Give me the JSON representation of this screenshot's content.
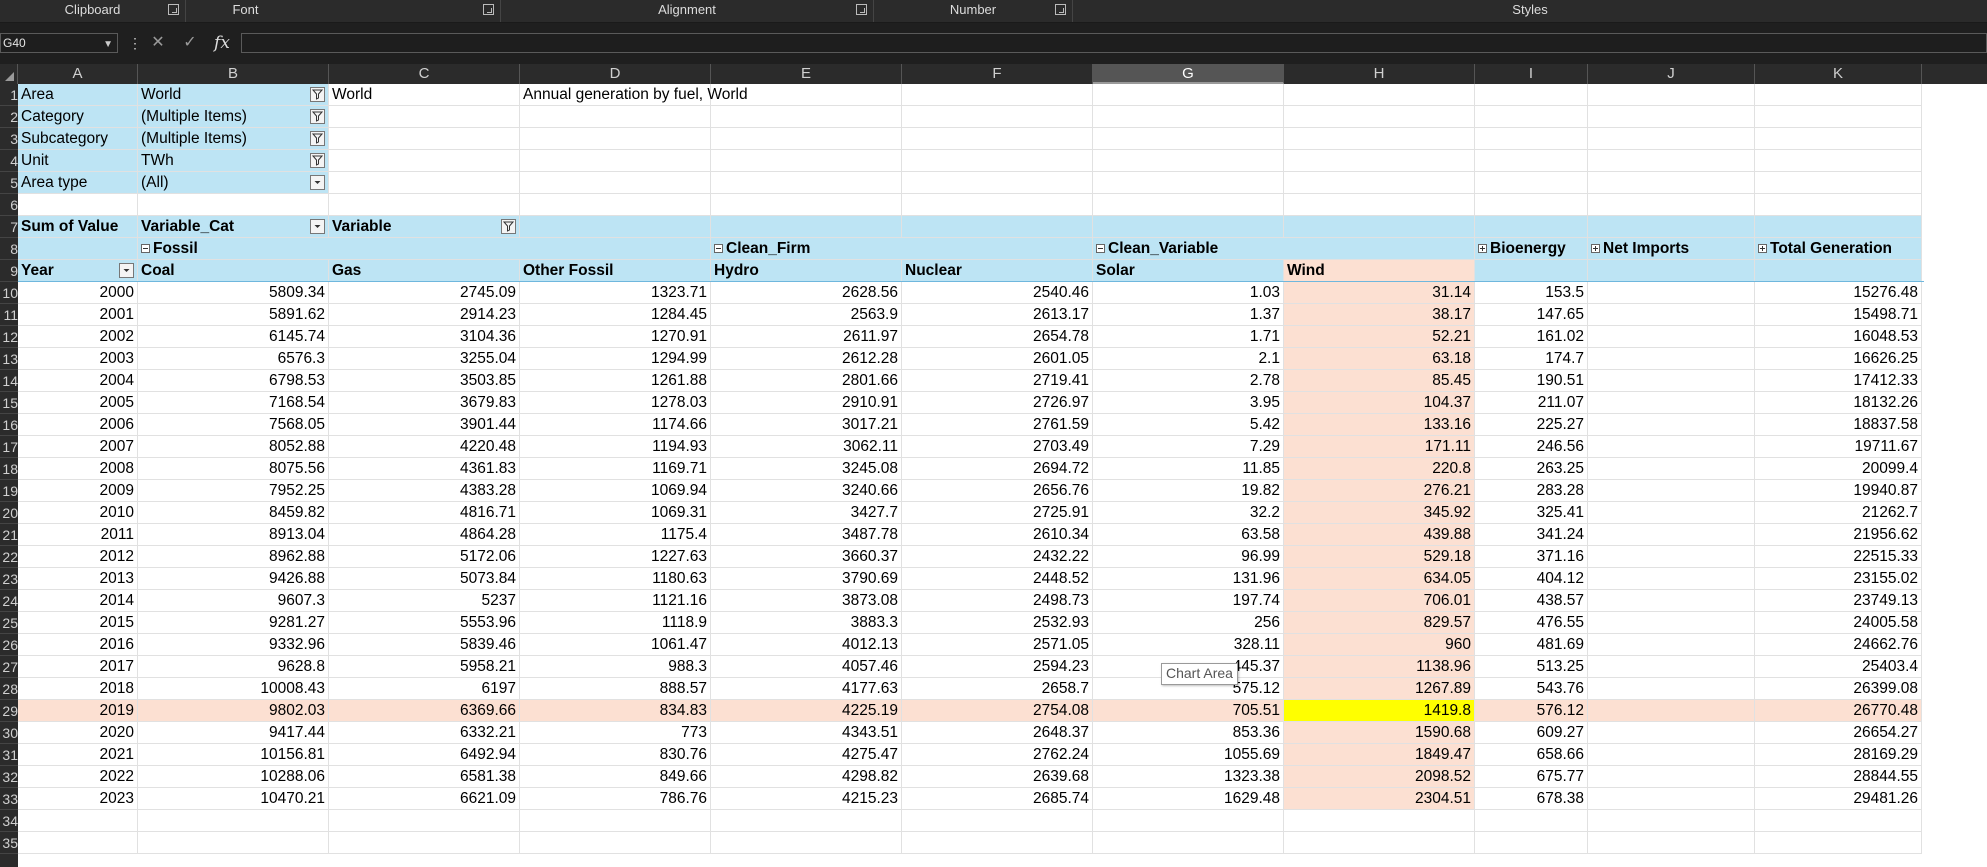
{
  "ribbon": {
    "groups": [
      {
        "label": "Clipboard"
      },
      {
        "label": "Font"
      },
      {
        "label": "Alignment"
      },
      {
        "label": "Number"
      },
      {
        "label": "Styles"
      }
    ]
  },
  "formula_bar": {
    "name_box": "G40",
    "value": ""
  },
  "columns": [
    "A",
    "B",
    "C",
    "D",
    "E",
    "F",
    "G",
    "H",
    "I",
    "J",
    "K"
  ],
  "selected_column": "G",
  "rows": [
    "1",
    "2",
    "3",
    "4",
    "5",
    "6",
    "7",
    "8",
    "9",
    "10",
    "11",
    "12",
    "13",
    "14",
    "15",
    "16",
    "17",
    "18",
    "19",
    "20",
    "21",
    "22",
    "23",
    "24",
    "25",
    "26",
    "27",
    "28",
    "29",
    "30",
    "31",
    "32",
    "33",
    "34",
    "35"
  ],
  "filters": [
    {
      "label": "Area",
      "value": "World"
    },
    {
      "label": "Category",
      "value": "(Multiple Items)"
    },
    {
      "label": "Subcategory",
      "value": "(Multiple Items)"
    },
    {
      "label": "Unit",
      "value": "TWh"
    },
    {
      "label": "Area type",
      "value": "(All)"
    }
  ],
  "extra": {
    "c1": "World",
    "d1": "Annual generation by fuel, World"
  },
  "pivot": {
    "sum_label": "Sum of Value",
    "col_field1": "Variable_Cat",
    "col_field2": "Variable",
    "groups": {
      "fossil": "Fossil",
      "clean_firm": "Clean_Firm",
      "clean_variable": "Clean_Variable",
      "bioenergy": "Bioenergy",
      "net_imports": "Net Imports",
      "total": "Total Generation"
    },
    "row_field": "Year",
    "headers": [
      "Coal",
      "Gas",
      "Other Fossil",
      "Hydro",
      "Nuclear",
      "Solar",
      "Wind"
    ],
    "data": [
      [
        "2000",
        "5809.34",
        "2745.09",
        "1323.71",
        "2628.56",
        "2540.46",
        "1.03",
        "31.14",
        "153.5",
        "",
        "15276.48"
      ],
      [
        "2001",
        "5891.62",
        "2914.23",
        "1284.45",
        "2563.9",
        "2613.17",
        "1.37",
        "38.17",
        "147.65",
        "",
        "15498.71"
      ],
      [
        "2002",
        "6145.74",
        "3104.36",
        "1270.91",
        "2611.97",
        "2654.78",
        "1.71",
        "52.21",
        "161.02",
        "",
        "16048.53"
      ],
      [
        "2003",
        "6576.3",
        "3255.04",
        "1294.99",
        "2612.28",
        "2601.05",
        "2.1",
        "63.18",
        "174.7",
        "",
        "16626.25"
      ],
      [
        "2004",
        "6798.53",
        "3503.85",
        "1261.88",
        "2801.66",
        "2719.41",
        "2.78",
        "85.45",
        "190.51",
        "",
        "17412.33"
      ],
      [
        "2005",
        "7168.54",
        "3679.83",
        "1278.03",
        "2910.91",
        "2726.97",
        "3.95",
        "104.37",
        "211.07",
        "",
        "18132.26"
      ],
      [
        "2006",
        "7568.05",
        "3901.44",
        "1174.66",
        "3017.21",
        "2761.59",
        "5.42",
        "133.16",
        "225.27",
        "",
        "18837.58"
      ],
      [
        "2007",
        "8052.88",
        "4220.48",
        "1194.93",
        "3062.11",
        "2703.49",
        "7.29",
        "171.11",
        "246.56",
        "",
        "19711.67"
      ],
      [
        "2008",
        "8075.56",
        "4361.83",
        "1169.71",
        "3245.08",
        "2694.72",
        "11.85",
        "220.8",
        "263.25",
        "",
        "20099.4"
      ],
      [
        "2009",
        "7952.25",
        "4383.28",
        "1069.94",
        "3240.66",
        "2656.76",
        "19.82",
        "276.21",
        "283.28",
        "",
        "19940.87"
      ],
      [
        "2010",
        "8459.82",
        "4816.71",
        "1069.31",
        "3427.7",
        "2725.91",
        "32.2",
        "345.92",
        "325.41",
        "",
        "21262.7"
      ],
      [
        "2011",
        "8913.04",
        "4864.28",
        "1175.4",
        "3487.78",
        "2610.34",
        "63.58",
        "439.88",
        "341.24",
        "",
        "21956.62"
      ],
      [
        "2012",
        "8962.88",
        "5172.06",
        "1227.63",
        "3660.37",
        "2432.22",
        "96.99",
        "529.18",
        "371.16",
        "",
        "22515.33"
      ],
      [
        "2013",
        "9426.88",
        "5073.84",
        "1180.63",
        "3790.69",
        "2448.52",
        "131.96",
        "634.05",
        "404.12",
        "",
        "23155.02"
      ],
      [
        "2014",
        "9607.3",
        "5237",
        "1121.16",
        "3873.08",
        "2498.73",
        "197.74",
        "706.01",
        "438.57",
        "",
        "23749.13"
      ],
      [
        "2015",
        "9281.27",
        "5553.96",
        "1118.9",
        "3883.3",
        "2532.93",
        "256",
        "829.57",
        "476.55",
        "",
        "24005.58"
      ],
      [
        "2016",
        "9332.96",
        "5839.46",
        "1061.47",
        "4012.13",
        "2571.05",
        "328.11",
        "960",
        "481.69",
        "",
        "24662.76"
      ],
      [
        "2017",
        "9628.8",
        "5958.21",
        "988.3",
        "4057.46",
        "2594.23",
        "445.37",
        "1138.96",
        "513.25",
        "",
        "25403.4"
      ],
      [
        "2018",
        "10008.43",
        "6197",
        "888.57",
        "4177.63",
        "2658.7",
        "575.12",
        "1267.89",
        "543.76",
        "",
        "26399.08"
      ],
      [
        "2019",
        "9802.03",
        "6369.66",
        "834.83",
        "4225.19",
        "2754.08",
        "705.51",
        "1419.8",
        "576.12",
        "",
        "26770.48"
      ],
      [
        "2020",
        "9417.44",
        "6332.21",
        "773",
        "4343.51",
        "2648.37",
        "853.36",
        "1590.68",
        "609.27",
        "",
        "26654.27"
      ],
      [
        "2021",
        "10156.81",
        "6492.94",
        "830.76",
        "4275.47",
        "2762.24",
        "1055.69",
        "1849.47",
        "658.66",
        "",
        "28169.29"
      ],
      [
        "2022",
        "10288.06",
        "6581.38",
        "849.66",
        "4298.82",
        "2639.68",
        "1323.38",
        "2098.52",
        "675.77",
        "",
        "28844.55"
      ],
      [
        "2023",
        "10470.21",
        "6621.09",
        "786.76",
        "4215.23",
        "2685.74",
        "1629.48",
        "2304.51",
        "678.38",
        "",
        "29481.26"
      ]
    ]
  },
  "tooltip": "Chart Area",
  "colors": {
    "pivot_header": "#bde4f4",
    "highlight_row": "#fce0d2",
    "highlight_cell": "#ffff00"
  }
}
